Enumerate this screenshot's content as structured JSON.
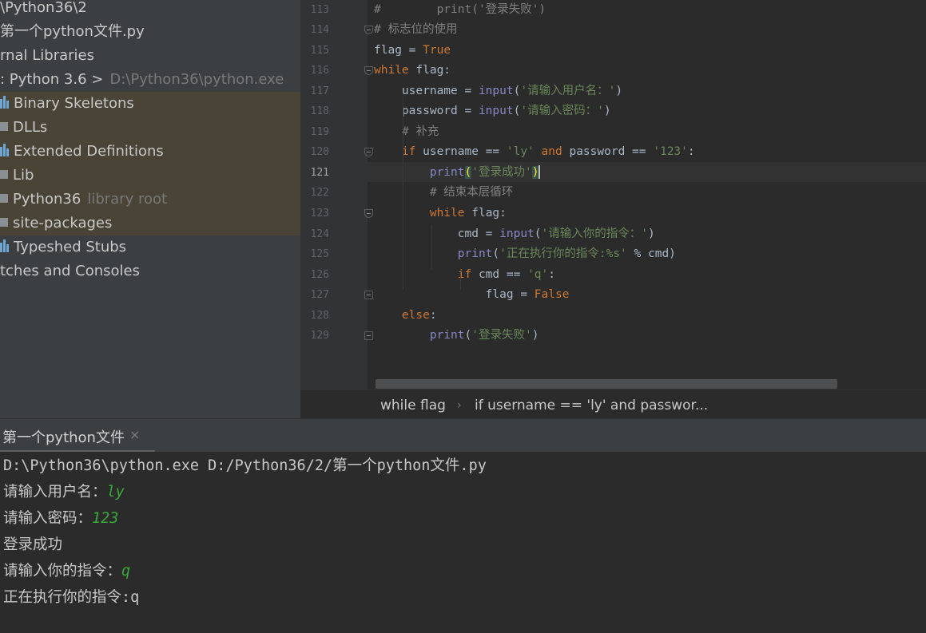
{
  "project_tree": {
    "rows": [
      {
        "text": "\\Python36\\2"
      },
      {
        "text": "第一个python文件.py"
      },
      {
        "text": "rnal Libraries"
      },
      {
        "text": ": Python 3.6 >",
        "dim": "D:\\Python36\\python.exe"
      },
      {
        "text": "Binary Skeletons",
        "icon": "library-icon"
      },
      {
        "text": "DLLs",
        "icon": "folder-icon"
      },
      {
        "text": "Extended Definitions",
        "icon": "library-icon"
      },
      {
        "text": "Lib",
        "icon": "folder-icon"
      },
      {
        "text": "Python36",
        "dim": "library root",
        "icon": "folder-icon"
      },
      {
        "text": "site-packages",
        "icon": "folder-icon"
      },
      {
        "text": "Typeshed Stubs",
        "icon": "library-icon"
      },
      {
        "text": "tches and Consoles"
      }
    ]
  },
  "editor": {
    "line_numbers": [
      "113",
      "114",
      "115",
      "116",
      "117",
      "118",
      "119",
      "120",
      "121",
      "122",
      "123",
      "124",
      "125",
      "126",
      "127",
      "128",
      "129"
    ],
    "current_line": "121",
    "lines": [
      [
        {
          "c": "cm",
          "t": "#        print('登录失败')"
        }
      ],
      [
        {
          "c": "cm",
          "t": "# 标志位的使用"
        }
      ],
      [
        {
          "c": "",
          "t": "flag = "
        },
        {
          "c": "bool",
          "t": "True"
        }
      ],
      [
        {
          "c": "kw",
          "t": "while"
        },
        {
          "c": "",
          "t": " flag:"
        }
      ],
      [
        {
          "c": "",
          "t": "    username = "
        },
        {
          "c": "fn",
          "t": "input"
        },
        {
          "c": "",
          "t": "("
        },
        {
          "c": "str",
          "t": "'请输入用户名：'"
        },
        {
          "c": "",
          "t": ")"
        }
      ],
      [
        {
          "c": "",
          "t": "    password = "
        },
        {
          "c": "fn",
          "t": "input"
        },
        {
          "c": "",
          "t": "("
        },
        {
          "c": "str",
          "t": "'请输入密码：'"
        },
        {
          "c": "",
          "t": ")"
        }
      ],
      [
        {
          "c": "cm",
          "t": "    # 补充"
        }
      ],
      [
        {
          "c": "kw",
          "t": "    if"
        },
        {
          "c": "",
          "t": " username == "
        },
        {
          "c": "str",
          "t": "'ly'"
        },
        {
          "c": "kw",
          "t": " and"
        },
        {
          "c": "",
          "t": " password == "
        },
        {
          "c": "str",
          "t": "'123'"
        },
        {
          "c": "",
          "t": ":"
        }
      ],
      [
        {
          "c": "fn",
          "t": "        print"
        },
        {
          "c": "br",
          "t": "("
        },
        {
          "c": "str",
          "t": "'登录成功'"
        },
        {
          "c": "br",
          "t": ")"
        }
      ],
      [
        {
          "c": "cm",
          "t": "        # 结束本层循环"
        }
      ],
      [
        {
          "c": "kw",
          "t": "        while"
        },
        {
          "c": "",
          "t": " flag:"
        }
      ],
      [
        {
          "c": "",
          "t": "            cmd = "
        },
        {
          "c": "fn",
          "t": "input"
        },
        {
          "c": "",
          "t": "("
        },
        {
          "c": "str",
          "t": "'请输入你的指令：'"
        },
        {
          "c": "",
          "t": ")"
        }
      ],
      [
        {
          "c": "fn",
          "t": "            print"
        },
        {
          "c": "",
          "t": "("
        },
        {
          "c": "str",
          "t": "'正在执行你的指令:%s'"
        },
        {
          "c": "",
          "t": " % cmd)"
        }
      ],
      [
        {
          "c": "kw",
          "t": "            if"
        },
        {
          "c": "",
          "t": " cmd == "
        },
        {
          "c": "str",
          "t": "'q'"
        },
        {
          "c": "",
          "t": ":"
        }
      ],
      [
        {
          "c": "",
          "t": "                flag = "
        },
        {
          "c": "bool",
          "t": "False"
        }
      ],
      [
        {
          "c": "kw",
          "t": "    else"
        },
        {
          "c": "",
          "t": ":"
        }
      ],
      [
        {
          "c": "fn",
          "t": "        print"
        },
        {
          "c": "",
          "t": "("
        },
        {
          "c": "str",
          "t": "'登录失败'"
        },
        {
          "c": "",
          "t": ")"
        }
      ]
    ]
  },
  "breadcrumb": {
    "item1": "while flag",
    "separator": "›",
    "item2": "if username == 'ly' and passwor..."
  },
  "run_panel": {
    "tab_label": "第一个python文件",
    "close_glyph": "×",
    "console": [
      [
        {
          "t": "D:\\Python36\\python.exe D:/Python36/2/第一个python文件.py"
        }
      ],
      [
        {
          "t": "请输入用户名："
        },
        {
          "t": "ly",
          "in": true
        }
      ],
      [
        {
          "t": "请输入密码："
        },
        {
          "t": "123",
          "in": true
        }
      ],
      [
        {
          "t": "登录成功"
        }
      ],
      [
        {
          "t": "请输入你的指令："
        },
        {
          "t": "q",
          "in": true
        }
      ],
      [
        {
          "t": "正在执行你的指令:q"
        }
      ]
    ]
  },
  "colors": {
    "keyword": "#cc7832",
    "string": "#6a8759",
    "builtin": "#8888c6",
    "comment": "#808080",
    "console_input": "#3aa83a"
  }
}
